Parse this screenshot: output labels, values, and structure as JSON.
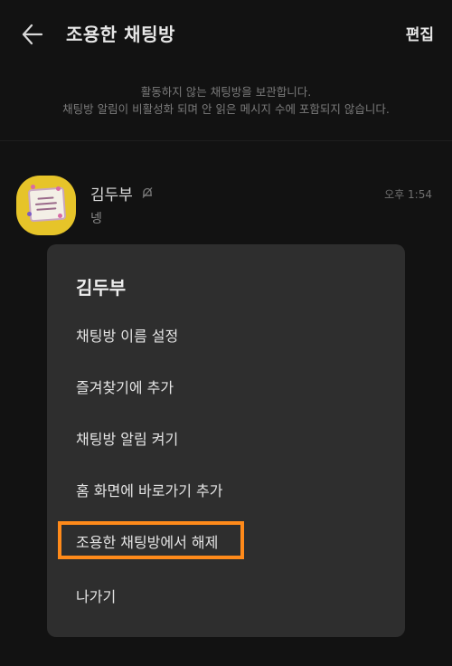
{
  "header": {
    "title": "조용한 채팅방",
    "edit_label": "편집",
    "back_icon": "arrow-left-icon"
  },
  "info": {
    "line1": "활동하지 않는 채팅방을 보관합니다.",
    "line2": "채팅방 알림이 비활성화 되며 안 읽은 메시지 수에 포함되지 않습니다."
  },
  "chat": {
    "name": "김두부",
    "time": "오후 1:54",
    "preview": "넹",
    "mute_icon": "bell-off-icon"
  },
  "context_menu": {
    "title": "김두부",
    "items": [
      "채팅방 이름 설정",
      "즐겨찾기에 추가",
      "채팅방 알림 켜기",
      "홈 화면에 바로가기 추가",
      "조용한 채팅방에서 해제",
      "나가기"
    ],
    "highlight_color": "#ff8a1a"
  }
}
